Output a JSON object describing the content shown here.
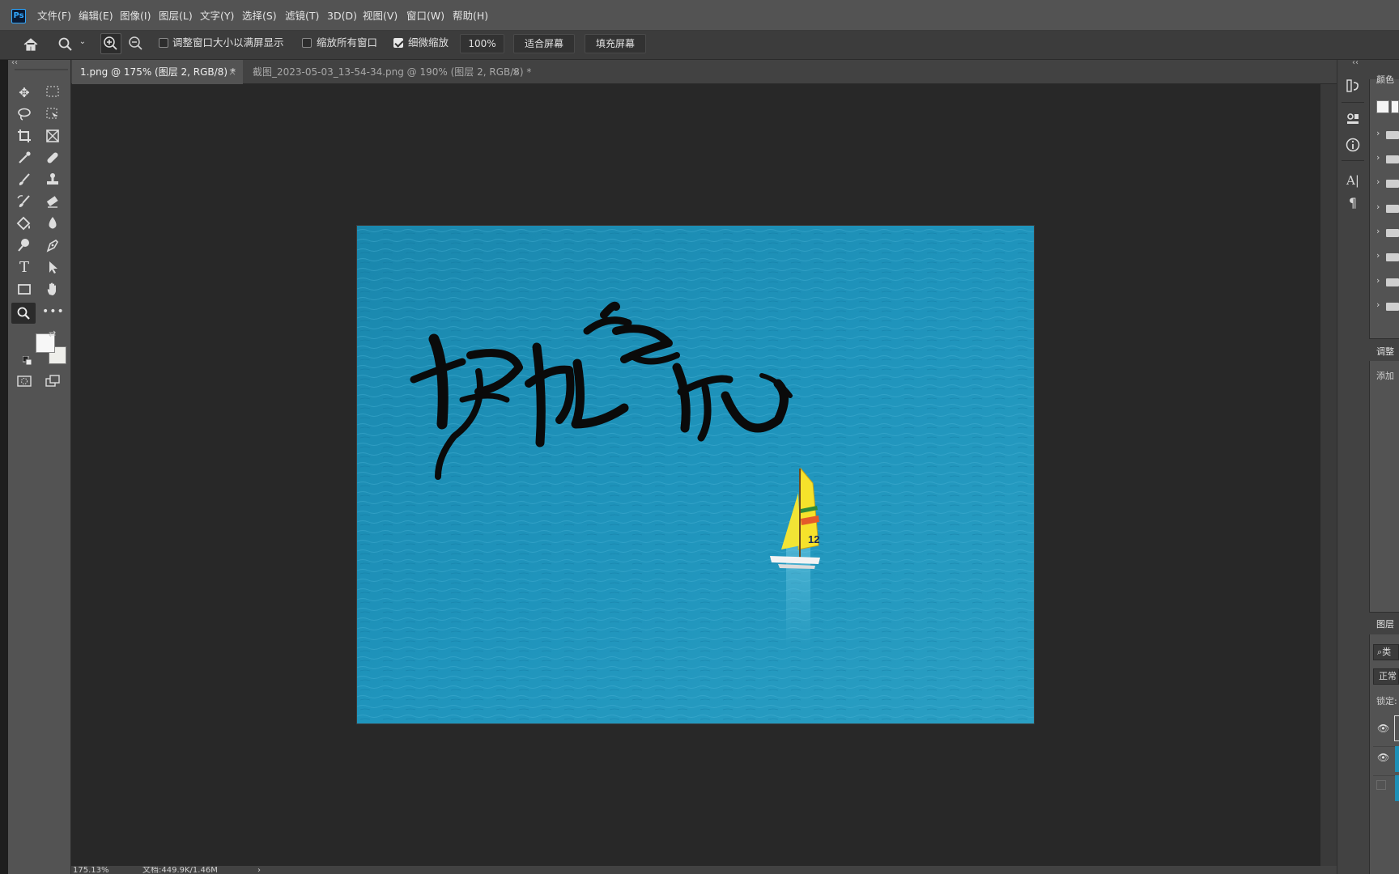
{
  "menu": {
    "logo": "Ps",
    "items": [
      "文件(F)",
      "编辑(E)",
      "图像(I)",
      "图层(L)",
      "文字(Y)",
      "选择(S)",
      "滤镜(T)",
      "3D(D)",
      "视图(V)",
      "窗口(W)",
      "帮助(H)"
    ]
  },
  "options": {
    "resize_windows_label": "调整窗口大小以满屏显示",
    "resize_windows_checked": false,
    "zoom_all_label": "缩放所有窗口",
    "zoom_all_checked": false,
    "scrubby_label": "细微缩放",
    "scrubby_checked": true,
    "zoom_value": "100%",
    "fit_screen": "适合屏幕",
    "fill_screen": "填充屏幕"
  },
  "tabs": [
    {
      "label": "1.png @ 175% (图层 2, RGB/8) *",
      "active": true
    },
    {
      "label": "截图_2023-05-03_13-54-34.png @ 190% (图层 2, RGB/8) *",
      "active": false
    }
  ],
  "canvas": {
    "calligraphy": "扬帆起航",
    "sail_number": "12"
  },
  "status": {
    "zoom": "175.13%",
    "doc_size": "文档:449.9K/1.46M"
  },
  "right_panel": {
    "color_title": "颜色",
    "adjust_title": "调整",
    "adjust_add": "添加",
    "layers_title": "图层",
    "search_kind": "类",
    "blend_mode": "正常",
    "lock_label": "锁定:"
  },
  "colors": {
    "ui_dark": "#535353",
    "canvas_bg": "#282828",
    "sea": "#1d8fb6",
    "sail": "#f6e22b"
  }
}
